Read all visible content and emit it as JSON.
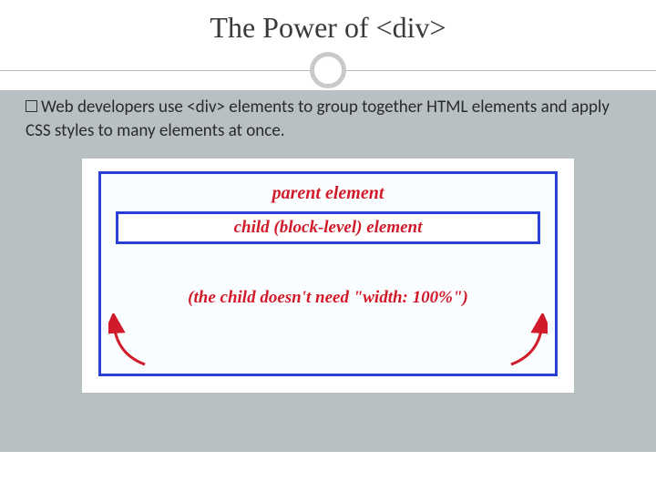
{
  "title": "The Power of <div>",
  "body_text": "Web developers use <div> elements to group together HTML elements and apply CSS styles to many elements at once.",
  "diagram": {
    "parent_label": "parent element",
    "child_label": "child (block-level) element",
    "caption": "(the child doesn't need \"width: 100%\")"
  },
  "colors": {
    "slide_bg": "#b8c0c4",
    "box_border": "#2a3fd4",
    "label_red": "#d11a2a"
  }
}
